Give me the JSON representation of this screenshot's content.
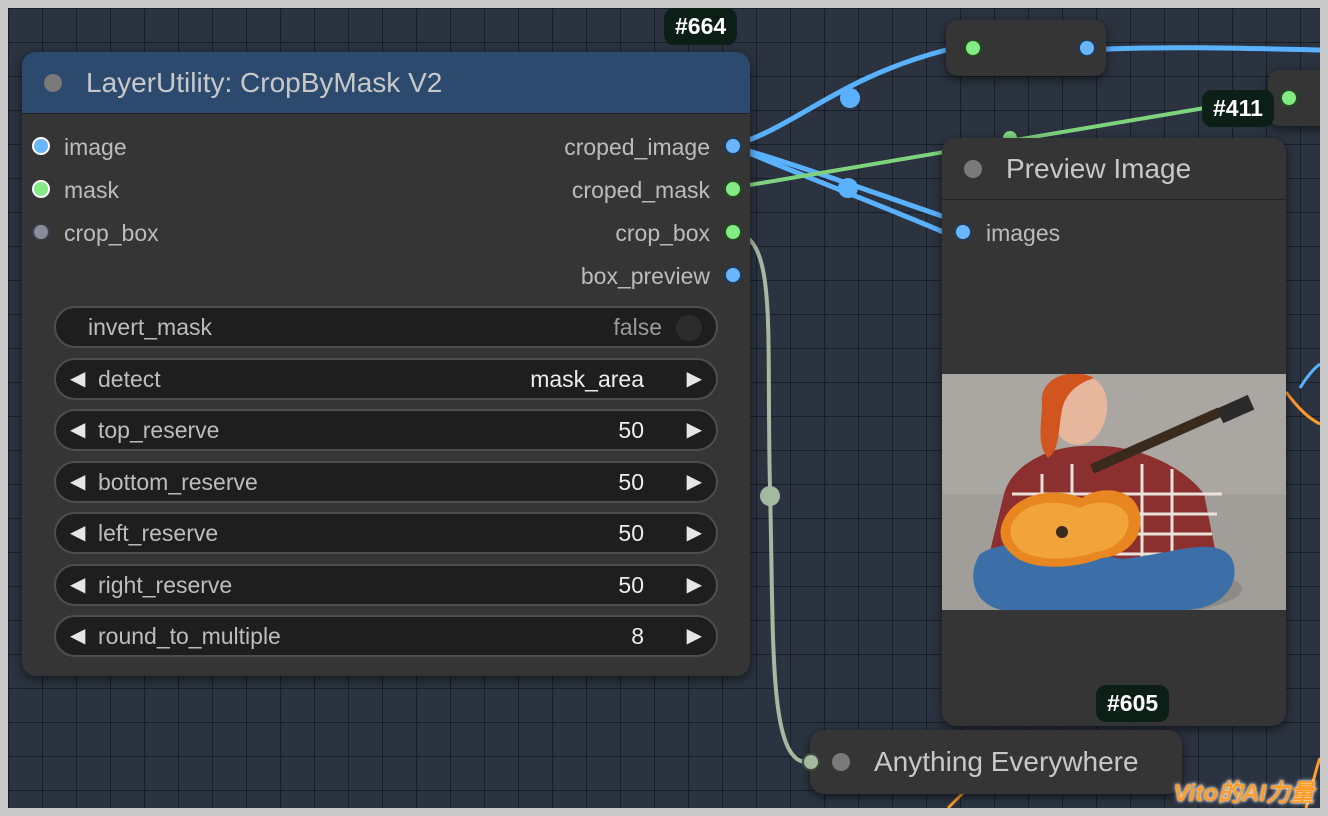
{
  "colors": {
    "image_link": "#5ab1ff",
    "mask_link": "#7ed37e",
    "crop_box_link": "#a5b8a0",
    "node_body": "#353535",
    "crop_node_header": "#2b4a6e",
    "badge_bg": "#0c1f16",
    "watermark": "#ff9b26"
  },
  "crop_node": {
    "id_badge": "#664",
    "title": "LayerUtility: CropByMask V2",
    "inputs": [
      {
        "label": "image",
        "type": "image"
      },
      {
        "label": "mask",
        "type": "mask"
      },
      {
        "label": "crop_box",
        "type": "box"
      }
    ],
    "outputs": [
      {
        "label": "croped_image"
      },
      {
        "label": "croped_mask"
      },
      {
        "label": "crop_box"
      },
      {
        "label": "box_preview"
      }
    ],
    "widgets": {
      "invert_mask": {
        "name": "invert_mask",
        "value": "false"
      },
      "detect": {
        "name": "detect",
        "value": "mask_area"
      },
      "top_reserve": {
        "name": "top_reserve",
        "value": "50"
      },
      "bottom_reserve": {
        "name": "bottom_reserve",
        "value": "50"
      },
      "left_reserve": {
        "name": "left_reserve",
        "value": "50"
      },
      "right_reserve": {
        "name": "right_reserve",
        "value": "50"
      },
      "round_to_multiple": {
        "name": "round_to_multiple",
        "value": "8"
      }
    },
    "arrow_left": "◀",
    "arrow_right": "▶"
  },
  "preview_node": {
    "id_badge": "#605",
    "title": "Preview Image",
    "input_label": "images",
    "image_description_icon": "photo-woman-with-guitar"
  },
  "other_badge": "#411",
  "anything_node": {
    "title": "Anything Everywhere"
  },
  "watermark": "Vito的AI力量"
}
